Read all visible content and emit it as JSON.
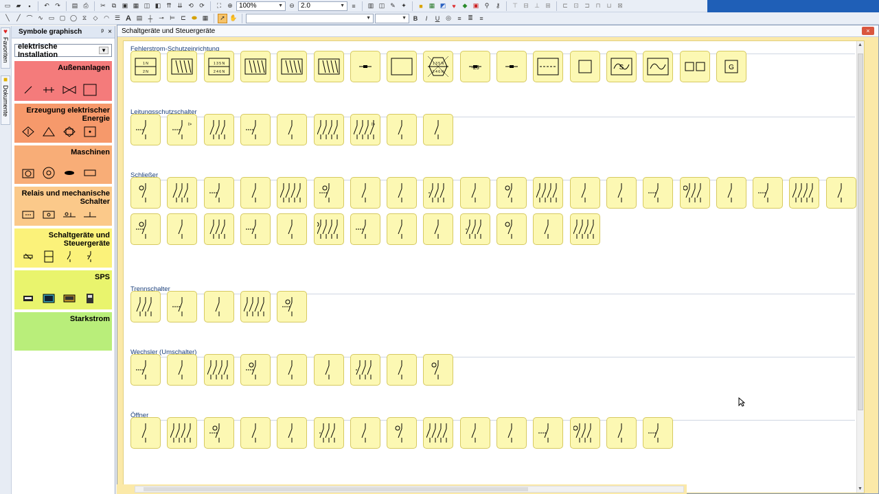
{
  "toolbar": {
    "zoom_value": "100%",
    "line_width_value": "2.0",
    "font_name_value": "",
    "font_size_value": "",
    "bold": "B",
    "italic": "I",
    "underline": "U",
    "text_tool": "A"
  },
  "side_tabs": {
    "favorites": "Favoriten",
    "documents": "Dokumente"
  },
  "symbol_panel": {
    "title": "Symbole graphisch",
    "pin": "ᵖ",
    "close": "×",
    "library": "elektrische Installation",
    "categories": [
      {
        "title": "Außenanlagen",
        "color": "#f47b7b"
      },
      {
        "title": "Erzeugung elektrischer Energie",
        "color": "#f6996b"
      },
      {
        "title": "Maschinen",
        "color": "#f8ad77"
      },
      {
        "title": "Relais und mechanische Schalter",
        "color": "#fbc98a"
      },
      {
        "title": "Schaltgeräte und Steuergeräte",
        "color": "#fbf27a"
      },
      {
        "title": "SPS",
        "color": "#e9f46d"
      },
      {
        "title": "Starkstrom",
        "color": "#b9ee7a"
      }
    ]
  },
  "window": {
    "title": "Schaltgeräte und Steuergeräte",
    "close": "×"
  },
  "sections": [
    {
      "label": "Fehlerstrom-Schutzeinrichtung",
      "count": 17,
      "texts": [
        "1 N / 2 N",
        "",
        "1 3 5 N / 2 4 6 N",
        "",
        "",
        "",
        "",
        "",
        "1 3 5 N / 2 4 6 N",
        "-25",
        "",
        "",
        "",
        "S",
        "",
        "",
        "G"
      ]
    },
    {
      "label": "Leitungsschutzschalter",
      "count": 9,
      "texts": [
        "",
        "I>",
        "",
        "",
        "",
        "",
        "I>"
      ]
    },
    {
      "label": "Schließer",
      "count": 33,
      "texts": []
    },
    {
      "label": "Trennschalter",
      "count": 5,
      "texts": []
    },
    {
      "label": "Wechsler (Umschalter)",
      "count": 9,
      "texts": []
    },
    {
      "label": "Öffner",
      "count": 15,
      "texts": []
    }
  ]
}
